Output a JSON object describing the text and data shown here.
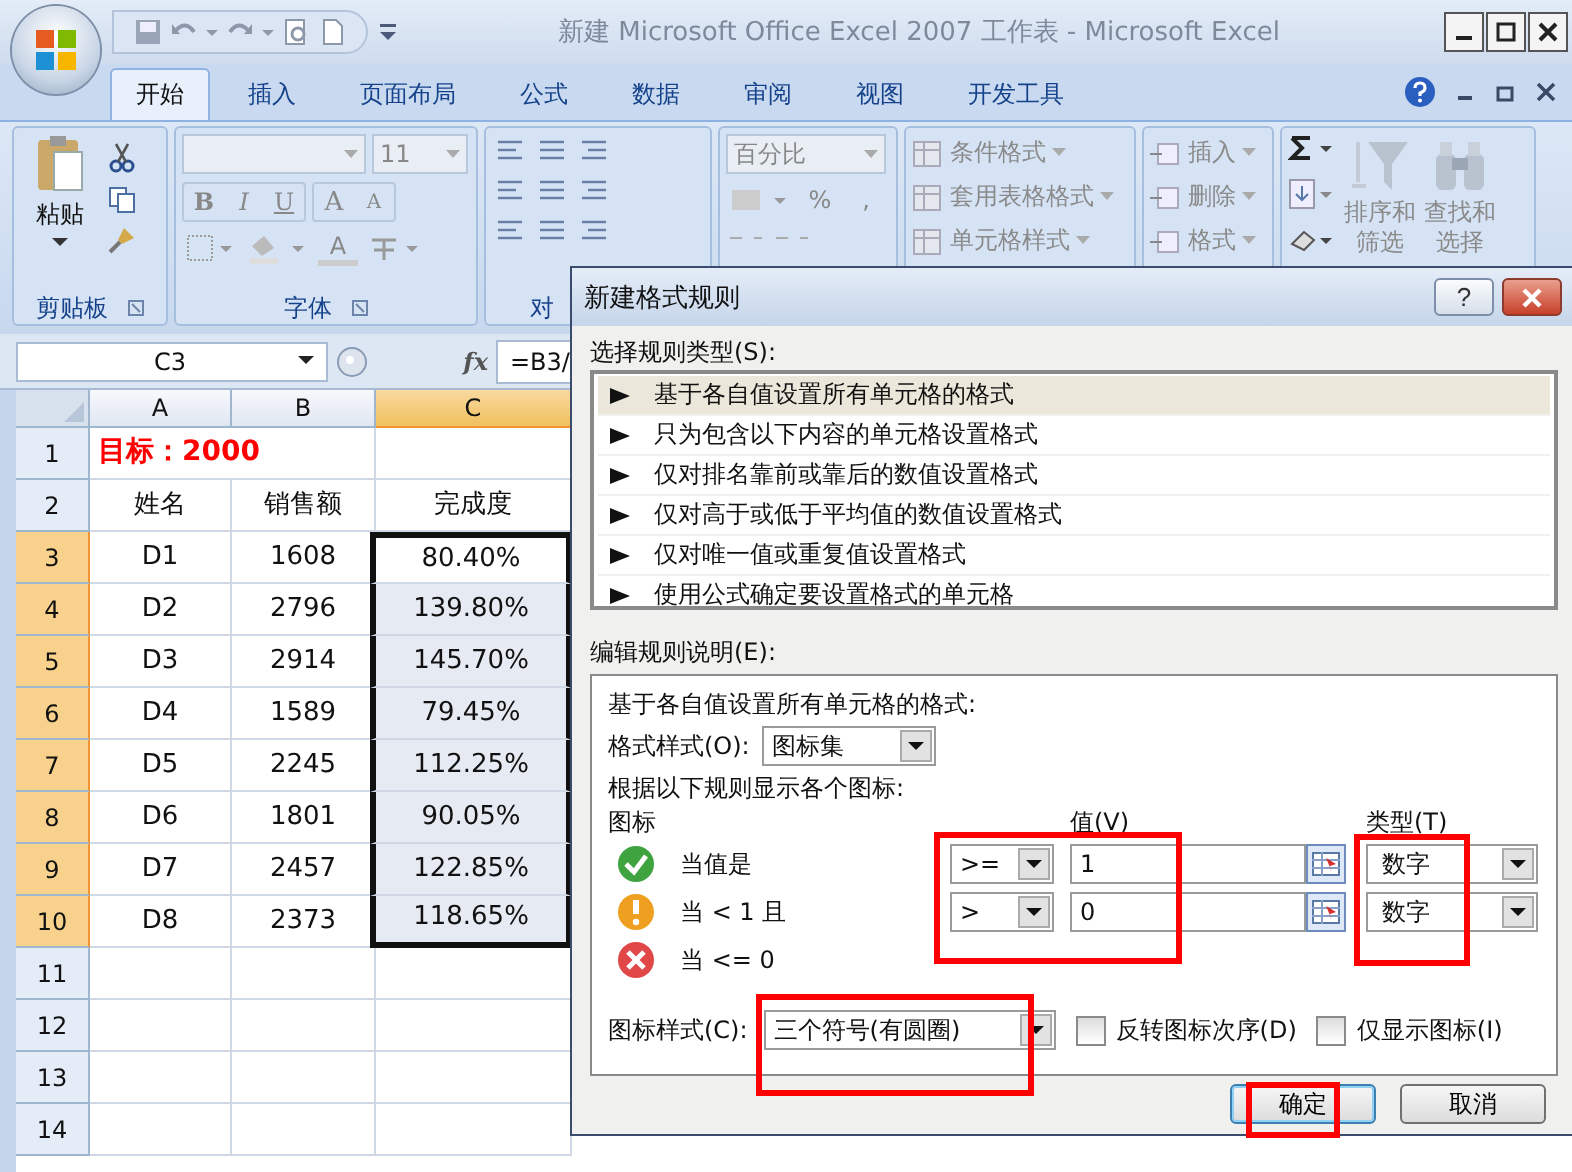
{
  "window": {
    "title": "新建 Microsoft Office Excel 2007 工作表 - Microsoft Excel"
  },
  "tabs": [
    {
      "label": "开始",
      "selected": true
    },
    {
      "label": "插入",
      "selected": false
    },
    {
      "label": "页面布局",
      "selected": false
    },
    {
      "label": "公式",
      "selected": false
    },
    {
      "label": "数据",
      "selected": false
    },
    {
      "label": "审阅",
      "selected": false
    },
    {
      "label": "视图",
      "selected": false
    },
    {
      "label": "开发工具",
      "selected": false
    }
  ],
  "ribbon": {
    "clipboard": {
      "paste": "粘贴",
      "label": "剪贴板"
    },
    "font": {
      "size": "11",
      "styles": [
        "B",
        "I",
        "U"
      ],
      "grow": [
        "A",
        "A"
      ],
      "color_button": "A",
      "label": "字体"
    },
    "alignment": {
      "label": "对"
    },
    "number": {
      "format": "百分比",
      "symbols": [
        "%",
        ","
      ]
    },
    "styles": [
      "条件格式",
      "套用表格格式",
      "单元格样式"
    ],
    "cells": [
      "插入",
      "删除",
      "格式"
    ],
    "editing": [
      {
        "line1": "排序和",
        "line2": "筛选"
      },
      {
        "line1": "查找和",
        "line2": "选择"
      }
    ]
  },
  "formula_bar": {
    "name_box": "C3",
    "function_label": "fx",
    "formula": "=B3/"
  },
  "sheet": {
    "columns": [
      {
        "label": "A",
        "selected": false
      },
      {
        "label": "B",
        "selected": false
      },
      {
        "label": "C",
        "selected": true
      }
    ],
    "rows": [
      {
        "number": "1",
        "kind": "title",
        "selected": false,
        "active": false,
        "text": "目标：2000"
      },
      {
        "number": "2",
        "kind": "data",
        "selected": false,
        "active": false,
        "cells": [
          "姓名",
          "销售额",
          "完成度"
        ]
      },
      {
        "number": "3",
        "kind": "data",
        "selected": true,
        "active": true,
        "cells": [
          "D1",
          "1608",
          "80.40%"
        ]
      },
      {
        "number": "4",
        "kind": "data",
        "selected": true,
        "active": false,
        "cells": [
          "D2",
          "2796",
          "139.80%"
        ]
      },
      {
        "number": "5",
        "kind": "data",
        "selected": true,
        "active": false,
        "cells": [
          "D3",
          "2914",
          "145.70%"
        ]
      },
      {
        "number": "6",
        "kind": "data",
        "selected": true,
        "active": false,
        "cells": [
          "D4",
          "1589",
          "79.45%"
        ]
      },
      {
        "number": "7",
        "kind": "data",
        "selected": true,
        "active": false,
        "cells": [
          "D5",
          "2245",
          "112.25%"
        ]
      },
      {
        "number": "8",
        "kind": "data",
        "selected": true,
        "active": false,
        "cells": [
          "D6",
          "1801",
          "90.05%"
        ]
      },
      {
        "number": "9",
        "kind": "data",
        "selected": true,
        "active": false,
        "cells": [
          "D7",
          "2457",
          "122.85%"
        ]
      },
      {
        "number": "10",
        "kind": "data",
        "selected": true,
        "active": false,
        "cells": [
          "D8",
          "2373",
          "118.65%"
        ]
      },
      {
        "number": "11",
        "kind": "empty",
        "selected": false,
        "active": false
      },
      {
        "number": "12",
        "kind": "empty",
        "selected": false,
        "active": false
      },
      {
        "number": "13",
        "kind": "empty",
        "selected": false,
        "active": false
      },
      {
        "number": "14",
        "kind": "empty",
        "selected": false,
        "active": false
      }
    ]
  },
  "dialog": {
    "title": "新建格式规则",
    "help": "?",
    "rule_type_label": "选择规则类型(S):",
    "rule_types": [
      {
        "label": "基于各自值设置所有单元格的格式",
        "selected": true
      },
      {
        "label": "只为包含以下内容的单元格设置格式",
        "selected": false
      },
      {
        "label": "仅对排名靠前或靠后的数值设置格式",
        "selected": false
      },
      {
        "label": "仅对高于或低于平均值的数值设置格式",
        "selected": false
      },
      {
        "label": "仅对唯一值或重复值设置格式",
        "selected": false
      },
      {
        "label": "使用公式确定要设置格式的单元格",
        "selected": false
      }
    ],
    "edit_label": "编辑规则说明(E):",
    "description": "基于各自值设置所有单元格的格式:",
    "format_style": {
      "label": "格式样式(O):",
      "value": "图标集"
    },
    "rules_caption": "根据以下规则显示各个图标:",
    "headers": {
      "icon": "图标",
      "value": "值(V)",
      "type": "类型(T)"
    },
    "conditions": [
      {
        "kind": "check",
        "text": "当值是",
        "operator": ">=",
        "value": "1",
        "type": "数字"
      },
      {
        "kind": "warning",
        "text": "当 < 1 且",
        "operator": ">",
        "value": "0",
        "type": "数字"
      },
      {
        "kind": "cross",
        "text": "当 <= 0"
      }
    ],
    "highlight_values": true,
    "highlight_types": true,
    "icon_style": {
      "label": "图标样式(C):",
      "value": "三个符号(有圆圈)",
      "highlighted": true
    },
    "checkboxes": [
      {
        "label": "反转图标次序(D)",
        "checked": false
      },
      {
        "label": "仅显示图标(I)",
        "checked": false
      }
    ],
    "buttons": [
      {
        "label": "确定",
        "default": true,
        "highlighted": true
      },
      {
        "label": "取消",
        "default": false,
        "highlighted": false
      }
    ]
  }
}
